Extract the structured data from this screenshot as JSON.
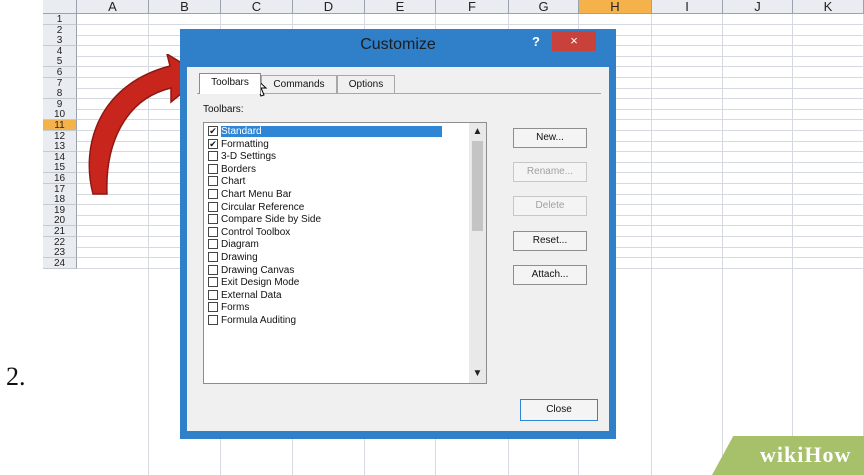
{
  "step_number": "2.",
  "sheet": {
    "columns": [
      "A",
      "B",
      "C",
      "D",
      "E",
      "F",
      "G",
      "H",
      "I",
      "J",
      "K"
    ],
    "selected_column": "H",
    "rows": [
      "1",
      "2",
      "3",
      "4",
      "5",
      "6",
      "7",
      "8",
      "9",
      "10",
      "11",
      "12",
      "13",
      "14",
      "15",
      "16",
      "17",
      "18",
      "19",
      "20",
      "21",
      "22",
      "23",
      "24"
    ],
    "selected_row": "11"
  },
  "dialog": {
    "title": "Customize",
    "help_label": "?",
    "close_label": "×",
    "tabs": [
      "Toolbars",
      "Commands",
      "Options"
    ],
    "active_tab": "Toolbars",
    "toolbars_label": "Toolbars:",
    "items": [
      {
        "label": "Standard",
        "checked": true,
        "selected": true
      },
      {
        "label": "Formatting",
        "checked": true
      },
      {
        "label": "3-D Settings",
        "checked": false
      },
      {
        "label": "Borders",
        "checked": false
      },
      {
        "label": "Chart",
        "checked": false
      },
      {
        "label": "Chart Menu Bar",
        "checked": false
      },
      {
        "label": "Circular Reference",
        "checked": false
      },
      {
        "label": "Compare Side by Side",
        "checked": false
      },
      {
        "label": "Control Toolbox",
        "checked": false
      },
      {
        "label": "Diagram",
        "checked": false
      },
      {
        "label": "Drawing",
        "checked": false
      },
      {
        "label": "Drawing Canvas",
        "checked": false
      },
      {
        "label": "Exit Design Mode",
        "checked": false
      },
      {
        "label": "External Data",
        "checked": false
      },
      {
        "label": "Forms",
        "checked": false
      },
      {
        "label": "Formula Auditing",
        "checked": false
      }
    ],
    "buttons": [
      {
        "label": "New...",
        "enabled": true
      },
      {
        "label": "Rename...",
        "enabled": false
      },
      {
        "label": "Delete",
        "enabled": false
      },
      {
        "label": "Reset...",
        "enabled": true
      },
      {
        "label": "Attach...",
        "enabled": true
      }
    ],
    "close_button": "Close"
  },
  "watermark": "wikiHow",
  "colors": {
    "dialog_frame": "#2f7fc9",
    "close_red": "#c9413b",
    "selection": "#2f86d6",
    "header_highlight": "#f5b24a",
    "arrow_red": "#c8261d",
    "watermark_green": "#a7c06a"
  }
}
